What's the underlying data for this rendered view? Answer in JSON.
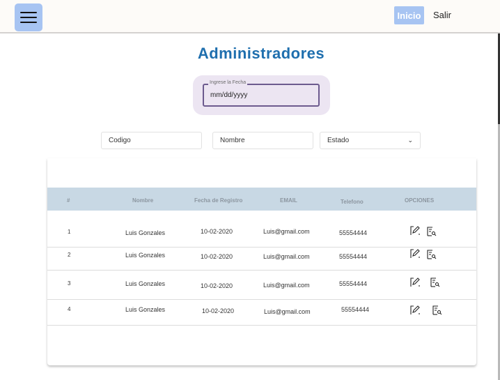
{
  "header": {
    "menu_icon": "hamburger-icon",
    "nav": [
      {
        "label": "Inicio"
      },
      {
        "label": "Salir"
      }
    ]
  },
  "page": {
    "title": "Administradores"
  },
  "date_filter": {
    "label": "Ingrese la Fecha",
    "value": "mm/dd/yyyy"
  },
  "filters": {
    "codigo": "Codigo",
    "nombre": "Nombre",
    "estado": "Estado"
  },
  "table": {
    "headers": [
      "#",
      "Nombre",
      "Fecha de Registro",
      "EMAIL",
      "Telefono",
      "OPCIONES"
    ],
    "rows": [
      {
        "num": "1",
        "nombre": "Luis Gonzales",
        "fecha": "10-02-2020",
        "email": "Luis@gmail.com",
        "telefono": "55554444"
      },
      {
        "num": "2",
        "nombre": "Luis Gonzales",
        "fecha": "10-02-2020",
        "email": "Luis@gmail.com",
        "telefono": "55554444"
      },
      {
        "num": "3",
        "nombre": "Luis Gonzales",
        "fecha": "10-02-2020",
        "email": "Luis@gmail.com",
        "telefono": "55554444"
      },
      {
        "num": "4",
        "nombre": "Luis Gonzales",
        "fecha": "10-02-2020",
        "email": "Luis@gmail.com",
        "telefono": "55554444"
      }
    ],
    "row_icons": [
      "edit-icon",
      "view-details-icon"
    ]
  },
  "colors": {
    "accent": "#a7c4f2",
    "title": "#1f6fae",
    "table_header": "#c8d8e4",
    "date_border": "#6c5a8e"
  }
}
